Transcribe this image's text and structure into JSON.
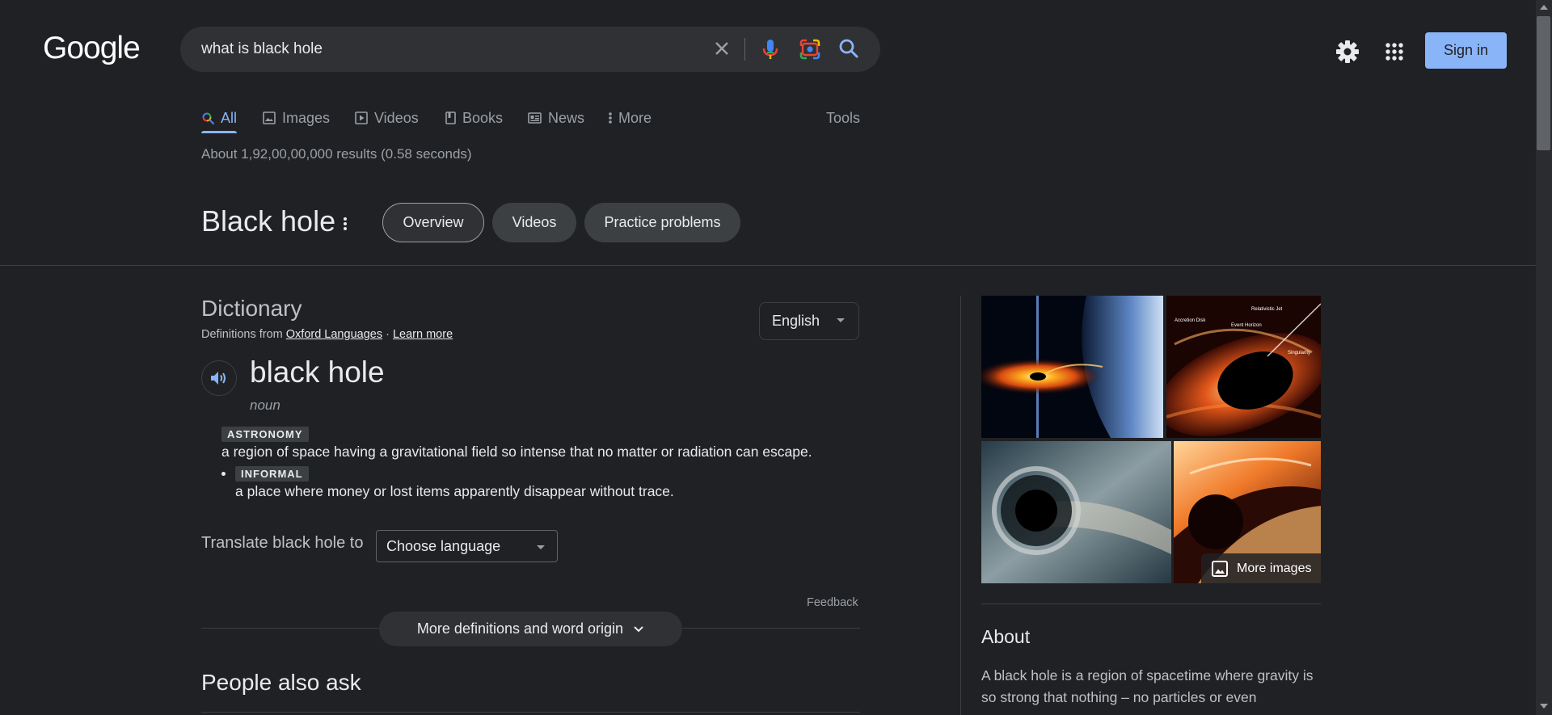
{
  "header": {
    "logo": "Google",
    "search_query": "what is black hole",
    "sign_in": "Sign in",
    "icons": [
      "close-icon",
      "mic-icon",
      "lens-icon",
      "search-icon",
      "gear-icon",
      "apps-grid-icon"
    ]
  },
  "tabs": [
    {
      "label": "All",
      "icon": "search-icon"
    },
    {
      "label": "Images",
      "icon": "image-icon"
    },
    {
      "label": "Videos",
      "icon": "video-icon"
    },
    {
      "label": "Books",
      "icon": "book-icon"
    },
    {
      "label": "News",
      "icon": "news-icon"
    },
    {
      "label": "More",
      "icon": "more-vert-icon"
    }
  ],
  "tools_label": "Tools",
  "result_stats": "About 1,92,00,00,000 results (0.58 seconds)",
  "entity": {
    "title": "Black hole",
    "chips": [
      "Overview",
      "Videos",
      "Practice problems"
    ]
  },
  "dictionary": {
    "title": "Dictionary",
    "source_prefix": "Definitions from",
    "source_link": "Oxford Languages",
    "separator": "·",
    "learn_more": "Learn more",
    "language": "English",
    "word": "black hole",
    "part_of_speech": "noun",
    "definitions": [
      {
        "label": "ASTRONOMY",
        "text": "a region of space having a gravitational field so intense that no matter or radiation can escape."
      },
      {
        "label": "INFORMAL",
        "text": "a place where money or lost items apparently disappear without trace."
      }
    ],
    "translate_label": "Translate black hole to",
    "choose_language": "Choose language",
    "feedback": "Feedback",
    "more_definitions": "More definitions and word origin"
  },
  "people_also_ask": "People also ask",
  "knowledge_panel": {
    "more_images": "More images",
    "image_labels": [
      "Relativistic Jet",
      "Accretion Disk",
      "Event Horizon",
      "Singularity"
    ],
    "about_title": "About",
    "about_text": "A black hole is a region of spacetime where gravity is so strong that nothing – no particles or even"
  },
  "colors": {
    "background": "#202124",
    "accent": "#8ab4f8",
    "surface": "#303134"
  }
}
